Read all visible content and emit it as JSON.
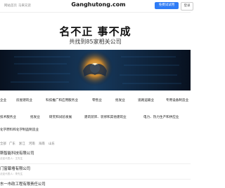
{
  "header": {
    "nav_links": [
      "网站首页",
      "马来兄弟"
    ],
    "site_name": "Ganghutong.com",
    "primary_button": "免费试试用",
    "secondary_button": "登录"
  },
  "hero": {
    "title": "名不正 事不成",
    "subtitle": "共找到85家相关公司"
  },
  "categories": [
    "企业",
    "房屋建筑业",
    "科技推广和应用服务业",
    "零售业",
    "批发业",
    "道路运输业",
    "专用设备制造业",
    "技术服务业",
    "批发业",
    "研究和试验发展",
    "建筑装饰、装修和其他建筑业",
    "电力、热力生产和供应业",
    "化学原料和化学制品制造业"
  ],
  "filter_tabs": [
    "全部",
    "广东",
    "浙江",
    "河南",
    "海南",
    "山东"
  ],
  "companies": [
    {
      "name": "斯智能科技有限公司",
      "meta": "法定代表人：王先生"
    },
    {
      "name": "门窗幕墙有限公司",
      "meta": "法定代表人：李先生"
    },
    {
      "name": "东一市政工程有限责任公司",
      "meta": "法定代表人：张先生"
    }
  ],
  "colors": {
    "accent": "#2f7cf6",
    "banner_bg": "#0a1426",
    "banner_glow": "#f5a623"
  }
}
